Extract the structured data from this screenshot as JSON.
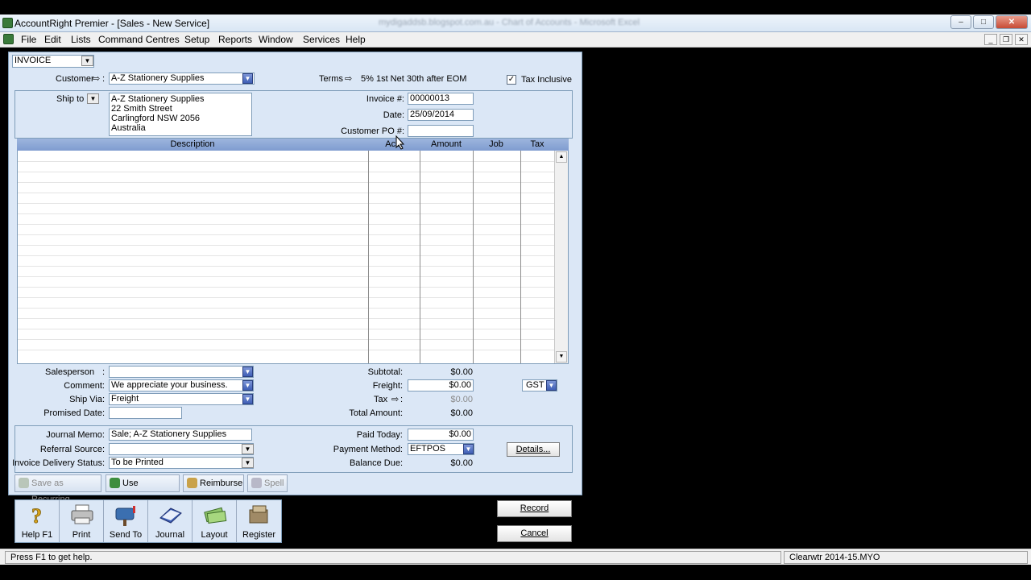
{
  "window": {
    "title": "AccountRight Premier - [Sales - New Service]",
    "blurred_tabs": "mydigaddsb.blogspot.com.au  -  Chart of Accounts  -  Microsoft Excel"
  },
  "menu": [
    "File",
    "Edit",
    "Lists",
    "Command Centres",
    "Setup",
    "Reports",
    "Window",
    "Services",
    "Help"
  ],
  "header": {
    "invoice_type": "INVOICE",
    "customer_label": "Customer",
    "customer_value": "A-Z Stationery Supplies",
    "terms_label": "Terms",
    "terms_value": "5% 1st Net 30th after EOM",
    "tax_inclusive_label": "Tax Inclusive",
    "tax_inclusive_checked": true
  },
  "ship_to": {
    "label": "Ship to",
    "lines": [
      "A-Z Stationery Supplies",
      "22 Smith Street",
      "Carlingford  NSW  2056",
      "Australia"
    ]
  },
  "invoice_fields": {
    "invoice_no_label": "Invoice #:",
    "invoice_no": "00000013",
    "date_label": "Date:",
    "date": "25/09/2014",
    "customer_po_label": "Customer PO #:",
    "customer_po": ""
  },
  "grid": {
    "columns": [
      "Description",
      "Acct",
      "Amount",
      "Job",
      "Tax"
    ]
  },
  "footer_left": {
    "salesperson_label": "Salesperson",
    "salesperson": "",
    "comment_label": "Comment:",
    "comment": "We appreciate your business.",
    "ship_via_label": "Ship Via:",
    "ship_via": "Freight",
    "promised_date_label": "Promised Date:",
    "promised_date": ""
  },
  "totals": {
    "subtotal_label": "Subtotal:",
    "subtotal": "$0.00",
    "freight_label": "Freight:",
    "freight": "$0.00",
    "tax_label": "Tax",
    "tax": "$0.00",
    "total_label": "Total Amount:",
    "total": "$0.00",
    "freight_tax_code": "GST"
  },
  "payment": {
    "journal_memo_label": "Journal Memo:",
    "journal_memo": "Sale; A-Z Stationery Supplies",
    "referral_label": "Referral Source:",
    "referral": "",
    "delivery_label": "Invoice Delivery Status:",
    "delivery": "To be Printed",
    "paid_today_label": "Paid Today:",
    "paid_today": "$0.00",
    "payment_method_label": "Payment Method:",
    "payment_method": "EFTPOS",
    "balance_due_label": "Balance Due:",
    "balance_due": "$0.00",
    "details_button": "Details..."
  },
  "toolbar": {
    "save_recurring": "Save as Recurring",
    "use_recurring": "Use Recurring",
    "reimburse": "Reimburse",
    "spell": "Spell"
  },
  "actions": {
    "help": "Help F1",
    "print": "Print",
    "send_to": "Send To",
    "journal": "Journal",
    "layout": "Layout",
    "register": "Register",
    "record": "Record",
    "cancel": "Cancel"
  },
  "status": {
    "help_text": "Press F1 to get help.",
    "file": "Clearwtr 2014-15.MYO"
  }
}
